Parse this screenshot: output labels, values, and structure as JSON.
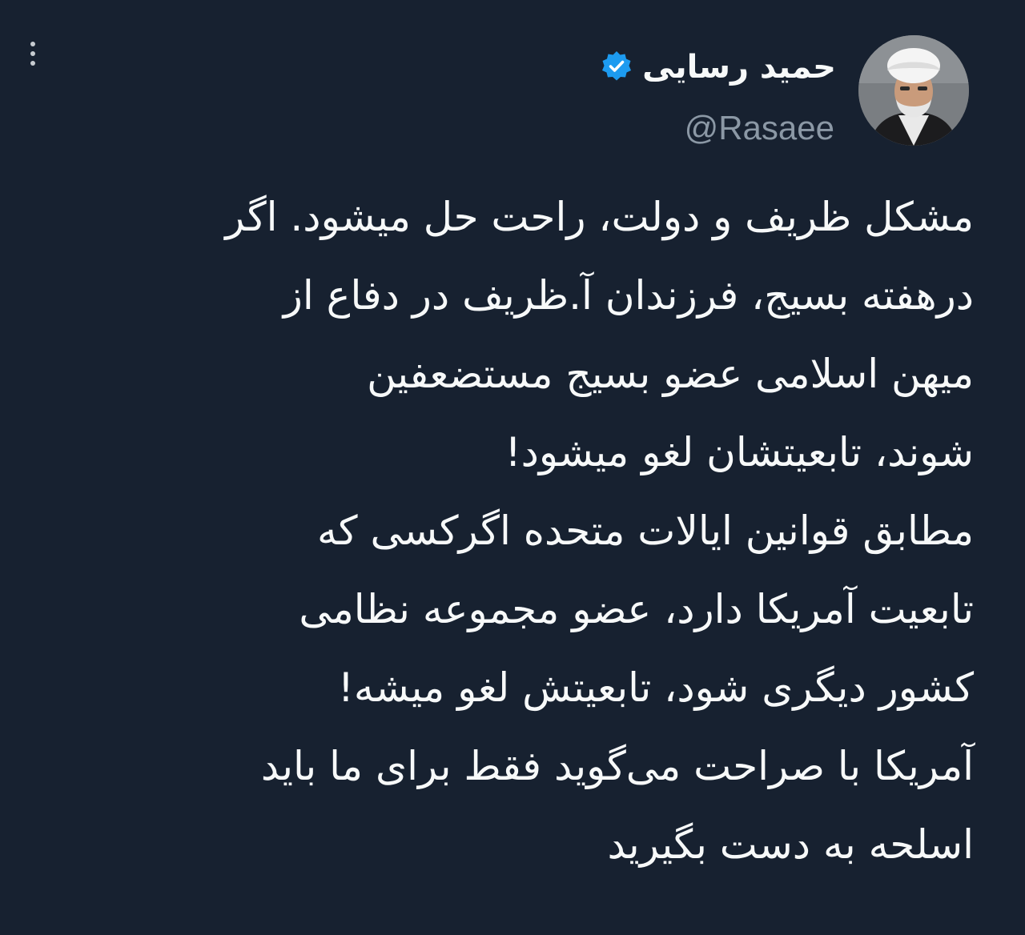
{
  "author": {
    "display_name": "حمید رسایی",
    "handle": "@Rasaee",
    "verified": true
  },
  "tweet": {
    "lines": [
      "مشکل ظریف و دولت، راحت حل میشود. اگر",
      "درهفته بسیج، فرزندان آ.ظریف در دفاع از",
      "میهن اسلامی عضو بسیج مستضعفین",
      "شوند، تابعیتشان لغو میشود!",
      "مطابق قوانین ایالات متحده اگرکسی که",
      "تابعیت آمریکا دارد، عضو مجموعه نظامی",
      "کشور دیگری شود، تابعیتش لغو میشه!",
      "آمریکا با صراحت می‌گوید فقط برای ما باید",
      "اسلحه به دست بگیرید"
    ]
  },
  "icons": {
    "more": "more-vertical-icon",
    "verified": "verified-badge-icon"
  },
  "colors": {
    "background": "#172130",
    "text_primary": "#f7f9f9",
    "text_secondary": "#8b98a5",
    "verified_blue": "#1d9bf0"
  }
}
